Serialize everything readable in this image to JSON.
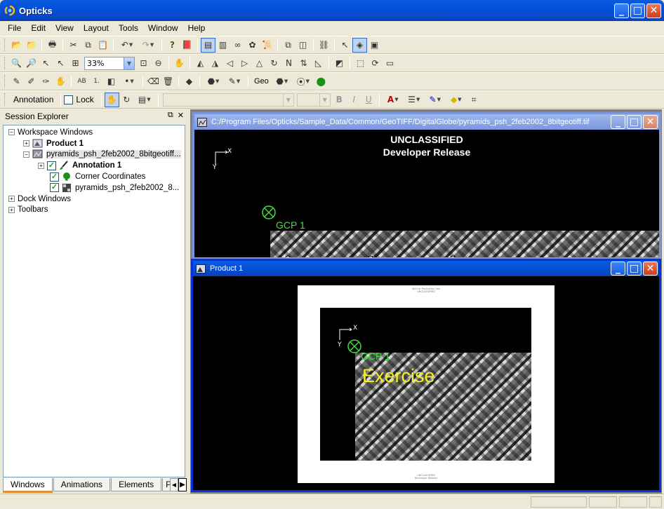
{
  "app": {
    "title": "Opticks",
    "accent": "#0a48c8"
  },
  "menu": [
    "File",
    "Edit",
    "View",
    "Layout",
    "Tools",
    "Window",
    "Help"
  ],
  "toolbar_zoom": {
    "value": "33%"
  },
  "toolbar_geo_label": "Geo",
  "annotation_toolbar": {
    "annotation_label": "Annotation",
    "lock_label": "Lock"
  },
  "session_explorer": {
    "title": "Session Explorer",
    "tree": [
      {
        "label": "Workspace Windows",
        "level": 0,
        "expander": "−"
      },
      {
        "label": "Product 1",
        "level": 1,
        "expander": "+",
        "bold": true,
        "icon": "product-icon"
      },
      {
        "label": "pyramids_psh_2feb2002_8bitgeotiff...",
        "level": 1,
        "expander": "−",
        "icon": "spatial-data-icon"
      },
      {
        "label": "Annotation 1",
        "level": 2,
        "expander": "+",
        "checked": true,
        "bold": true,
        "icon": "annotation-brush-icon"
      },
      {
        "label": "Corner Coordinates",
        "level": 2,
        "checked": true,
        "icon": "gcp-layer-icon"
      },
      {
        "label": "pyramids_psh_2feb2002_8...",
        "level": 2,
        "checked": true,
        "icon": "raster-layer-icon"
      },
      {
        "label": "Dock Windows",
        "level": 0,
        "expander": "+"
      },
      {
        "label": "Toolbars",
        "level": 0,
        "expander": "+"
      }
    ],
    "tabs": [
      "Windows",
      "Animations",
      "Elements",
      "P"
    ],
    "active_tab": "Windows"
  },
  "spatial_window": {
    "title": "C:/Program Files/Opticks/Sample_Data/Common/GeoTIFF/DigitalGlobe/pyramids_psh_2feb2002_8bitgeotiff.tif",
    "banner_line1": "UNCLASSIFIED",
    "banner_line2": "Developer Release",
    "axis_x": "X",
    "axis_y": "Y",
    "gcp_label": "GCP 1"
  },
  "product_window": {
    "title": "Product 1",
    "page_header_line1": "Not For Production Use",
    "page_header_line2": "UNCLASSIFIED",
    "page_footer_line1": "UNCLASSIFIED",
    "page_footer_line2": "Developer Release",
    "axis_x": "X",
    "axis_y": "Y",
    "gcp_label": "GCP 1",
    "annotation_text": "Exercise"
  }
}
